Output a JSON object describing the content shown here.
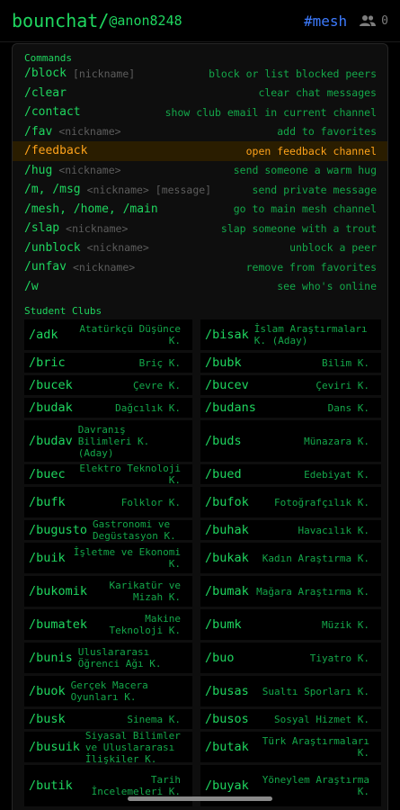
{
  "header": {
    "app": "bounchat/",
    "user": "@anon8248",
    "channel": "#mesh",
    "peer_count": "0",
    "peers_icon": "people-icon"
  },
  "commands_title": "Commands",
  "commands": [
    {
      "name": "/block",
      "param": "[nickname]",
      "desc": "block or list blocked peers"
    },
    {
      "name": "/clear",
      "param": "",
      "desc": "clear chat messages"
    },
    {
      "name": "/contact",
      "param": "",
      "desc": "show club email in current channel"
    },
    {
      "name": "/fav",
      "param": "<nickname>",
      "desc": "add to favorites"
    },
    {
      "name": "/feedback",
      "param": "",
      "desc": "open feedback channel"
    },
    {
      "name": "/hug",
      "param": "<nickname>",
      "desc": "send someone a warm hug"
    },
    {
      "name": "/m, /msg",
      "param": "<nickname> [message]",
      "desc": "send private message"
    },
    {
      "name": "/mesh, /home, /main",
      "param": "",
      "desc": "go to main mesh channel"
    },
    {
      "name": "/slap",
      "param": "<nickname>",
      "desc": "slap someone with a trout"
    },
    {
      "name": "/unblock",
      "param": "<nickname>",
      "desc": "unblock a peer"
    },
    {
      "name": "/unfav",
      "param": "<nickname>",
      "desc": "remove from favorites"
    },
    {
      "name": "/w",
      "param": "",
      "desc": "see who's online"
    }
  ],
  "clubs_title": "Student Clubs",
  "clubs": [
    {
      "cmd": "/adk",
      "name": "Atatürkçü Düşünce K."
    },
    {
      "cmd": "/bisak",
      "name": "İslam Araştırmaları K. (Aday)"
    },
    {
      "cmd": "/bric",
      "name": "Briç K."
    },
    {
      "cmd": "/bubk",
      "name": "Bilim K."
    },
    {
      "cmd": "/bucek",
      "name": "Çevre K."
    },
    {
      "cmd": "/bucev",
      "name": "Çeviri K."
    },
    {
      "cmd": "/budak",
      "name": "Dağcılık K."
    },
    {
      "cmd": "/budans",
      "name": "Dans K."
    },
    {
      "cmd": "/budav",
      "name": "Davranış Bilimleri K. (Aday)"
    },
    {
      "cmd": "/buds",
      "name": "Münazara K."
    },
    {
      "cmd": "/buec",
      "name": "Elektro Teknoloji K."
    },
    {
      "cmd": "/bued",
      "name": "Edebiyat K."
    },
    {
      "cmd": "/bufk",
      "name": "Folklor K."
    },
    {
      "cmd": "/bufok",
      "name": "Fotoğrafçılık K."
    },
    {
      "cmd": "/bugusto",
      "name": "Gastronomi ve Degüstasyon K."
    },
    {
      "cmd": "/buhak",
      "name": "Havacılık K."
    },
    {
      "cmd": "/buik",
      "name": "İşletme ve Ekonomi K."
    },
    {
      "cmd": "/bukak",
      "name": "Kadın Araştırma K."
    },
    {
      "cmd": "/bukomik",
      "name": "Karikatür ve Mizah K."
    },
    {
      "cmd": "/bumak",
      "name": "Mağara Araştırma K."
    },
    {
      "cmd": "/bumatek",
      "name": "Makine Teknoloji K."
    },
    {
      "cmd": "/bumk",
      "name": "Müzik K."
    },
    {
      "cmd": "/bunis",
      "name": "Uluslararası Öğrenci Ağı K."
    },
    {
      "cmd": "/buo",
      "name": "Tiyatro K."
    },
    {
      "cmd": "/buok",
      "name": "Gerçek Macera Oyunları K."
    },
    {
      "cmd": "/busas",
      "name": "Sualtı Sporları K."
    },
    {
      "cmd": "/busk",
      "name": "Sinema K."
    },
    {
      "cmd": "/busos",
      "name": "Sosyal Hizmet K."
    },
    {
      "cmd": "/busuik",
      "name": "Siyasal Bilimler ve Uluslararası İlişkiler K."
    },
    {
      "cmd": "/butak",
      "name": "Türk Araştırmaları K."
    },
    {
      "cmd": "/butik",
      "name": "Tarih İncelemeleri K."
    },
    {
      "cmd": "/buyak",
      "name": "Yöneylem Araştırma K."
    }
  ],
  "colors": {
    "accent": "#1fd65f",
    "highlight": "#ffa31a",
    "channel": "#3d7bff",
    "background": "#000000"
  }
}
